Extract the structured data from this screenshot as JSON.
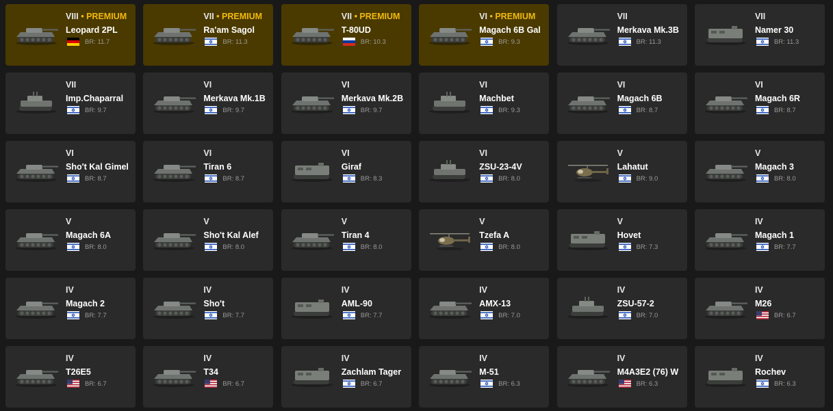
{
  "colors": {
    "background": "#191919",
    "card": "#2a2a2a",
    "premium_card": "#4a3a00",
    "premium_text": "#f1b90e"
  },
  "vehicles": [
    {
      "rank": "VIII",
      "premium_label": "• PREMIUM",
      "name": "Leopard 2PL",
      "flag": "germany",
      "br": "BR: 11.7",
      "kind": "tank"
    },
    {
      "rank": "VII",
      "premium_label": "• PREMIUM",
      "name": "Ra'am Sagol",
      "flag": "israel",
      "br": "BR: 11.3",
      "kind": "tank"
    },
    {
      "rank": "VII",
      "premium_label": "• PREMIUM",
      "name": "T-80UD",
      "flag": "russia",
      "br": "BR: 10.3",
      "kind": "tank"
    },
    {
      "rank": "VI",
      "premium_label": "• PREMIUM",
      "name": "Magach 6B Gal",
      "flag": "israel",
      "br": "BR: 9.3",
      "kind": "tank"
    },
    {
      "rank": "VII",
      "premium_label": "",
      "name": "Merkava Mk.3B",
      "flag": "israel",
      "br": "BR: 11.3",
      "kind": "tank"
    },
    {
      "rank": "VII",
      "premium_label": "",
      "name": "Namer 30",
      "flag": "israel",
      "br": "BR: 11.3",
      "kind": "apc"
    },
    {
      "rank": "VII",
      "premium_label": "",
      "name": "Imp.Chaparral",
      "flag": "israel",
      "br": "BR: 9.7",
      "kind": "spaa"
    },
    {
      "rank": "VI",
      "premium_label": "",
      "name": "Merkava Mk.1B",
      "flag": "israel",
      "br": "BR: 9.7",
      "kind": "tank"
    },
    {
      "rank": "VI",
      "premium_label": "",
      "name": "Merkava Mk.2B",
      "flag": "israel",
      "br": "BR: 9.7",
      "kind": "tank"
    },
    {
      "rank": "VI",
      "premium_label": "",
      "name": "Machbet",
      "flag": "israel",
      "br": "BR: 9.3",
      "kind": "spaa"
    },
    {
      "rank": "VI",
      "premium_label": "",
      "name": "Magach 6B",
      "flag": "israel",
      "br": "BR: 8.7",
      "kind": "tank"
    },
    {
      "rank": "VI",
      "premium_label": "",
      "name": "Magach 6R",
      "flag": "israel",
      "br": "BR: 8.7",
      "kind": "tank"
    },
    {
      "rank": "VI",
      "premium_label": "",
      "name": "Sho't Kal Gimel",
      "flag": "israel",
      "br": "BR: 8.7",
      "kind": "tank"
    },
    {
      "rank": "VI",
      "premium_label": "",
      "name": "Tiran 6",
      "flag": "israel",
      "br": "BR: 8.7",
      "kind": "tank"
    },
    {
      "rank": "VI",
      "premium_label": "",
      "name": "Giraf",
      "flag": "israel",
      "br": "BR: 8.3",
      "kind": "apc"
    },
    {
      "rank": "VI",
      "premium_label": "",
      "name": "ZSU-23-4V",
      "flag": "israel",
      "br": "BR: 8.0",
      "kind": "spaa"
    },
    {
      "rank": "V",
      "premium_label": "",
      "name": "Lahatut",
      "flag": "israel",
      "br": "BR: 9.0",
      "kind": "heli"
    },
    {
      "rank": "V",
      "premium_label": "",
      "name": "Magach 3",
      "flag": "israel",
      "br": "BR: 8.0",
      "kind": "tank"
    },
    {
      "rank": "V",
      "premium_label": "",
      "name": "Magach 6A",
      "flag": "israel",
      "br": "BR: 8.0",
      "kind": "tank"
    },
    {
      "rank": "V",
      "premium_label": "",
      "name": "Sho't Kal Alef",
      "flag": "israel",
      "br": "BR: 8.0",
      "kind": "tank"
    },
    {
      "rank": "V",
      "premium_label": "",
      "name": "Tiran 4",
      "flag": "israel",
      "br": "BR: 8.0",
      "kind": "tank"
    },
    {
      "rank": "V",
      "premium_label": "",
      "name": "Tzefa A",
      "flag": "israel",
      "br": "BR: 8.0",
      "kind": "heli"
    },
    {
      "rank": "V",
      "premium_label": "",
      "name": "Hovet",
      "flag": "israel",
      "br": "BR: 7.3",
      "kind": "apc"
    },
    {
      "rank": "IV",
      "premium_label": "",
      "name": "Magach 1",
      "flag": "israel",
      "br": "BR: 7.7",
      "kind": "tank"
    },
    {
      "rank": "IV",
      "premium_label": "",
      "name": "Magach 2",
      "flag": "israel",
      "br": "BR: 7.7",
      "kind": "tank"
    },
    {
      "rank": "IV",
      "premium_label": "",
      "name": "Sho't",
      "flag": "israel",
      "br": "BR: 7.7",
      "kind": "tank"
    },
    {
      "rank": "IV",
      "premium_label": "",
      "name": "AML-90",
      "flag": "israel",
      "br": "BR: 7.7",
      "kind": "apc"
    },
    {
      "rank": "IV",
      "premium_label": "",
      "name": "AMX-13",
      "flag": "israel",
      "br": "BR: 7.0",
      "kind": "tank"
    },
    {
      "rank": "IV",
      "premium_label": "",
      "name": "ZSU-57-2",
      "flag": "israel",
      "br": "BR: 7.0",
      "kind": "spaa"
    },
    {
      "rank": "IV",
      "premium_label": "",
      "name": "M26",
      "flag": "usa",
      "br": "BR: 6.7",
      "kind": "tank"
    },
    {
      "rank": "IV",
      "premium_label": "",
      "name": "T26E5",
      "flag": "usa",
      "br": "BR: 6.7",
      "kind": "tank"
    },
    {
      "rank": "IV",
      "premium_label": "",
      "name": "T34",
      "flag": "usa",
      "br": "BR: 6.7",
      "kind": "tank"
    },
    {
      "rank": "IV",
      "premium_label": "",
      "name": "Zachlam Tager",
      "flag": "israel",
      "br": "BR: 6.7",
      "kind": "apc"
    },
    {
      "rank": "IV",
      "premium_label": "",
      "name": "M-51",
      "flag": "israel",
      "br": "BR: 6.3",
      "kind": "tank"
    },
    {
      "rank": "IV",
      "premium_label": "",
      "name": "M4A3E2 (76) W",
      "flag": "usa",
      "br": "BR: 6.3",
      "kind": "tank"
    },
    {
      "rank": "IV",
      "premium_label": "",
      "name": "Rochev",
      "flag": "israel",
      "br": "BR: 6.3",
      "kind": "apc"
    }
  ]
}
